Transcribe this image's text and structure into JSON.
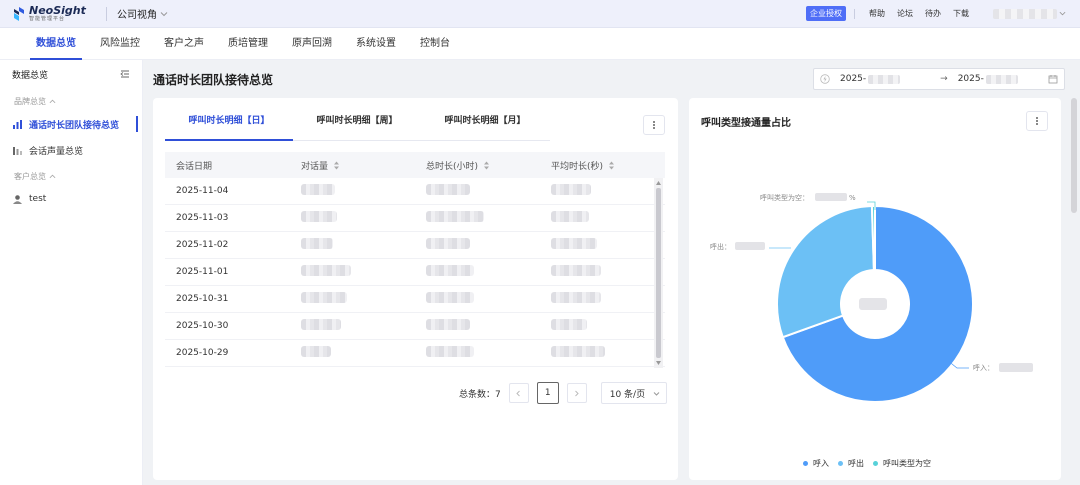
{
  "app": {
    "logo_name": "NeoSight",
    "logo_sub": "智能管理平台",
    "view_switch": "公司视角",
    "enterprise_badge": "企业授权",
    "top_links": [
      "帮助",
      "论坛",
      "待办",
      "下载"
    ]
  },
  "nav": {
    "items": [
      {
        "label": "数据总览",
        "active": true
      },
      {
        "label": "风险监控",
        "active": false
      },
      {
        "label": "客户之声",
        "active": false
      },
      {
        "label": "质培管理",
        "active": false
      },
      {
        "label": "原声回溯",
        "active": false
      },
      {
        "label": "系统设置",
        "active": false
      },
      {
        "label": "控制台",
        "active": false
      }
    ]
  },
  "sidebar": {
    "title": "数据总览",
    "group_brand": "品牌总览",
    "item_call_team": "通话时长团队接待总览",
    "item_voice": "会话声量总览",
    "group_customer": "客户总览",
    "item_test": "test"
  },
  "page": {
    "title": "通话时长团队接待总览",
    "date_start": "2025-",
    "date_arrow": "→",
    "date_end": "2025-"
  },
  "table_card": {
    "tabs": [
      {
        "label": "呼叫时长明细【日】",
        "active": true
      },
      {
        "label": "呼叫时长明细【周】",
        "active": false
      },
      {
        "label": "呼叫时长明细【月】",
        "active": false
      }
    ],
    "columns": [
      "会话日期",
      "对话量",
      "总时长(小时)",
      "平均时长(秒)"
    ],
    "rows": [
      {
        "date": "2025-11-04"
      },
      {
        "date": "2025-11-03"
      },
      {
        "date": "2025-11-02"
      },
      {
        "date": "2025-11-01"
      },
      {
        "date": "2025-10-31"
      },
      {
        "date": "2025-10-30"
      },
      {
        "date": "2025-10-29"
      }
    ],
    "total_label": "总条数：7",
    "current_page": "1",
    "page_size": "10 条/页"
  },
  "chart_card": {
    "title": "呼叫类型接通量占比",
    "label_empty": "呼叫类型为空：",
    "label_empty_tail": "%",
    "label_out": "呼出：",
    "label_in": "呼入："
  },
  "chart_data": {
    "type": "pie",
    "donut": true,
    "categories": [
      "呼入",
      "呼出",
      "呼叫类型为空"
    ],
    "values": [
      69.5,
      30.0,
      0.5
    ],
    "colors": [
      "#4f9cf9",
      "#6cc0f5",
      "#58d1d9"
    ],
    "legend_position": "bottom"
  }
}
